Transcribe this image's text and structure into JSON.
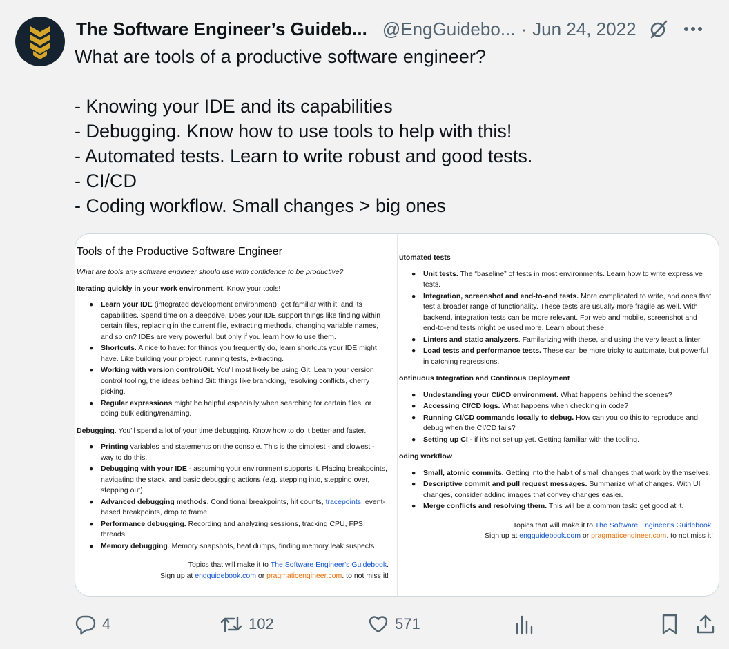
{
  "tweet": {
    "author_name": "The Software Engineer’s Guideb...",
    "handle": "@EngGuidebo...",
    "separator": "·",
    "date": "Jun 24, 2022",
    "lines": [
      "What are tools of a productive software engineer?",
      "",
      "- Knowing your IDE and its capabilities",
      "- Debugging. Know how to use tools to help with this!",
      "- Automated tests. Learn to write robust and good tests.",
      "- CI/CD",
      "- Coding workflow. Small changes > big ones"
    ]
  },
  "doc": {
    "title": "Tools of the Productive Software Engineer",
    "subtitle": "What are tools any software engineer should use with confidence to be productive?",
    "left": {
      "s1_bold": "Iterating quickly in your work environment",
      "s1_rest": ". Know your tools!",
      "s1_items": [
        {
          "b": "Learn your IDE",
          "t": " (integrated development environment): get familiar with it, and its capabilities. Spend time on a deepdive. Does your IDE support things like finding within certain files, replacing in the current file, extracting methods, changing variable names, and so on? IDEs are very powerful: but only if you learn how to use them."
        },
        {
          "b": "Shortcuts",
          "t": ". A nice to have: for things you frequently do, learn shortcuts your IDE might have. Like building your project, running tests, extracting."
        },
        {
          "b": "Working with version control/Git.",
          "t": " You'll most likely be using Git. Learn your version control tooling, the ideas behind Git: things like brancking, resolving conflicts, cherry picking."
        },
        {
          "b": "Regular expressions",
          "t": " might be helpful especially when searching for certain files, or doing bulk editing/renaming."
        }
      ],
      "s2_bold": "Debugging",
      "s2_rest": ". You'll spend a lot of your time debugging. Know how to do it better and faster.",
      "s2_items": [
        {
          "b": "Printing",
          "t": " variables and statements on the console. This is the simplest - and slowest - way to do this."
        },
        {
          "b": "Debugging with your IDE",
          "t": " - assuming your environment supports it. Placing breakpoints, navigating the stack, and basic debugging actions (e.g. stepping into, stepping over, stepping out)."
        },
        {
          "b": "Advanced debugging methods",
          "t": ". Conditional breakpoints, hit counts, ",
          "link": "tracepoints",
          "t2": ", event-based breakpoints, drop to frame"
        },
        {
          "b": "Performance debugging.",
          "t": " Recording and analyzing sessions, tracking CPU, FPS, threads."
        },
        {
          "b": "Memory debugging",
          "t": ". Memory snapshots, heat dumps, finding memory leak suspects"
        }
      ]
    },
    "right": {
      "s1_title": "utomated tests",
      "s1_items": [
        {
          "b": "Unit tests.",
          "t": " The “baseline” of tests in most environments. Learn how to write expressive tests."
        },
        {
          "b": "Integration, screenshot and end-to-end tests.",
          "t": " More complicated to write, and ones that test a broader range of functionality. These tests are usually more fragile as well. With backend, integration tests can be more relevant. For web and mobile, screenshot and end-to-end tests might be used more. Learn about these."
        },
        {
          "b": "Linters and static analyzers",
          "t": ". Familarizing with these, and using the very least a linter."
        },
        {
          "b": "Load tests and performance tests.",
          "t": " These can be more tricky to automate, but powerful in catching regressions."
        }
      ],
      "s2_title": "ontinuous Integration and Continous Deployment",
      "s2_items": [
        {
          "b": "Undestanding your CI/CD environment.",
          "t": " What happens behind the scenes?"
        },
        {
          "b": "Accessing CI/CD logs.",
          "t": " What happens when checking in code?"
        },
        {
          "b": "Running CI/CD commands locally to debug.",
          "t": " How can you do this to reproduce and debug when the CI/CD fails?"
        },
        {
          "b": "Setting up CI",
          "t": " - if it's not set up yet. Getting familiar with the tooling."
        }
      ],
      "s3_title": "oding workflow",
      "s3_items": [
        {
          "b": "Small, atomic commits.",
          "t": " Getting into the habit of small changes that work by themselves."
        },
        {
          "b": "Descriptive commit and pull request messages.",
          "t": " Summarize what changes. With UI changes, consider adding images that convey changes easier."
        },
        {
          "b": "Merge conflicts and resolving them.",
          "t": " This will be a common task: get good at it."
        }
      ]
    },
    "footer": {
      "line1_pre": "Topics that will make it to ",
      "line1_link": "The Software Engineer's Guidebook",
      "line1_post": ".",
      "line2_pre": "Sign up at ",
      "line2_link1": "engguidebook.com",
      "line2_mid": " or ",
      "line2_link2": "pragmaticengineer.com",
      "line2_post": ". to not miss it!"
    }
  },
  "actions": {
    "replies": "4",
    "retweets": "102",
    "likes": "571",
    "icons": [
      "reply-icon",
      "retweet-icon",
      "like-icon",
      "views-icon",
      "bookmark-icon",
      "share-icon"
    ]
  },
  "colors": {
    "background": "#f2f2f2",
    "text": "#0f1419",
    "muted": "#536471",
    "link_blue": "#1155cc",
    "link_orange": "#e8710a",
    "avatar_bg": "#14232f",
    "avatar_gold": "#d4a52a"
  }
}
